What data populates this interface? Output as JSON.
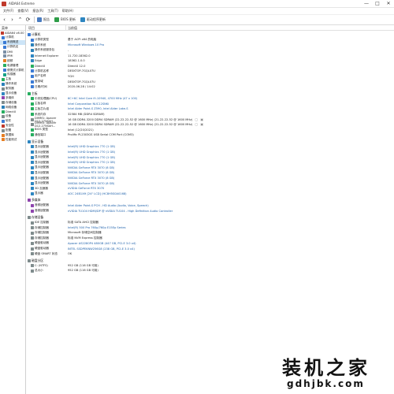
{
  "window": {
    "title": "AIDA64 Extreme",
    "controls": [
      "—",
      "□",
      "✕"
    ]
  },
  "menubar": {
    "items": [
      "文件(F)",
      "查看(V)",
      "报告(R)",
      "工具(T)",
      "帮助(H)"
    ]
  },
  "toolbar": {
    "nav": [
      "‹",
      "›",
      "⌃",
      "⟳"
    ],
    "items": [
      {
        "label": "报告",
        "color": "#4a7cc0"
      },
      {
        "label": "BIOS 更新",
        "color": "#2e9d48"
      },
      {
        "label": "驱动程序更新",
        "color": "#2e86c1"
      }
    ]
  },
  "sidebar": {
    "header": "菜单",
    "items": [
      {
        "label": "AIDA64 v6.00",
        "color": "#c0392b",
        "indent": 1
      },
      {
        "label": "计算机",
        "color": "#3a7bd5",
        "indent": 2
      },
      {
        "label": "系统概述",
        "color": "#3a7bd5",
        "indent": 4,
        "selected": true
      },
      {
        "label": "计算机名",
        "color": "#3a7bd5",
        "indent": 4
      },
      {
        "label": "DMI",
        "color": "#7b8fa6",
        "indent": 4
      },
      {
        "label": "IPMI",
        "color": "#7b8fa6",
        "indent": 4
      },
      {
        "label": "超频",
        "color": "#e67e22",
        "indent": 4
      },
      {
        "label": "电源管理",
        "color": "#27ae60",
        "indent": 4
      },
      {
        "label": "便携式计算机",
        "color": "#3a7bd5",
        "indent": 4
      },
      {
        "label": "传感器",
        "color": "#16a085",
        "indent": 4
      },
      {
        "label": "主板",
        "color": "#27ae60",
        "indent": 2
      },
      {
        "label": "操作系统",
        "color": "#2980b9",
        "indent": 2
      },
      {
        "label": "服务器",
        "color": "#7f8c8d",
        "indent": 2
      },
      {
        "label": "显示设备",
        "color": "#2e86c1",
        "indent": 2
      },
      {
        "label": "多媒体",
        "color": "#8e44ad",
        "indent": 2
      },
      {
        "label": "存储设备",
        "color": "#7f8c8d",
        "indent": 2
      },
      {
        "label": "网络设备",
        "color": "#2980b9",
        "indent": 2
      },
      {
        "label": "DirectX",
        "color": "#27ae60",
        "indent": 2
      },
      {
        "label": "设备",
        "color": "#7f8c8d",
        "indent": 2
      },
      {
        "label": "软件",
        "color": "#3a7bd5",
        "indent": 2
      },
      {
        "label": "安全性",
        "color": "#c0392b",
        "indent": 2
      },
      {
        "label": "配置",
        "color": "#7f8c8d",
        "indent": 2
      },
      {
        "label": "数据库",
        "color": "#e67e22",
        "indent": 2
      },
      {
        "label": "性能测试",
        "color": "#e67e22",
        "indent": 2
      }
    ]
  },
  "columns": {
    "field": "项目",
    "value": "当前值"
  },
  "sections": [
    {
      "title": "计算机",
      "color": "#3a7bd5",
      "rows": [
        {
          "field": "计算机类型",
          "value": "基于 ACPI x64 的电脑",
          "black": true,
          "color": "#3a7bd5"
        },
        {
          "field": "操作系统",
          "value": "Microsoft Windows 10 Pro",
          "color": "#2980b9"
        },
        {
          "field": "操作系统服务包",
          "value": "-",
          "black": true,
          "color": "#2980b9"
        },
        {
          "field": "Internet Explorer",
          "value": "11.720.18362.0",
          "black": true,
          "color": "#2e86c1"
        },
        {
          "field": "Edge",
          "value": "18362.1.0.0",
          "black": true,
          "color": "#2e86c1"
        },
        {
          "field": "DirectX",
          "value": "DirectX 12.0",
          "black": true,
          "color": "#27ae60"
        },
        {
          "field": "计算机名称",
          "value": "DESKTOP-7GQL07U",
          "black": true,
          "color": "#3a7bd5"
        },
        {
          "field": "用户名称",
          "value": "YGH",
          "black": true,
          "color": "#3a7bd5"
        },
        {
          "field": "登录域",
          "value": "DESKTOP-7GQL07U",
          "black": true,
          "color": "#3a7bd5"
        },
        {
          "field": "日期/时间",
          "value": "2020-06-28 / 14:02",
          "black": true,
          "color": "#3a7bd5"
        }
      ]
    },
    {
      "title": "主板",
      "color": "#27ae60",
      "rows": [
        {
          "field": "中央处理器(CPU)",
          "value": "6C+6C Intel Core i9-10940, 4700 MHz (47 x 100)",
          "color": "#27ae60"
        },
        {
          "field": "主板名称",
          "value": "Intel Corporation NUC12SNKi",
          "color": "#27ae60"
        },
        {
          "field": "主板芯片组",
          "value": "Intel Alder Point-S Z590, Intel Alder Lake-S",
          "color": "#27ae60"
        },
        {
          "field": "系统内存",
          "value": "32584 MB  (DDR4 SDRAM)",
          "black": true,
          "color": "#27ae60"
        },
        {
          "field": "DIMM1: Apacer D12.2756AH...",
          "value": "16 GB DDR4-3200 DDR4 SDRAM  (22-22-22-52 @ 1600 MHz)  (21-22-22-52 @ 1600 MHz)",
          "black": true,
          "color": "#7f8c8d",
          "icons": true
        },
        {
          "field": "DIMM3: Apacer D12.2756AH...",
          "value": "16 GB DDR4-3200 DDR4 SDRAM  (22-22-22-52 @ 1600 MHz)  (21-22-22-52 @ 1600 MHz)",
          "black": true,
          "color": "#7f8c8d",
          "icons": true
        },
        {
          "field": "BIOS 类型",
          "value": "Intel (12/20/2021)",
          "black": true,
          "color": "#27ae60"
        },
        {
          "field": "通信端口",
          "value": "Prolific PL2303GS USB Serial COM Port (COM3)",
          "black": true,
          "color": "#27ae60"
        }
      ]
    },
    {
      "title": "显示设备",
      "color": "#2e86c1",
      "rows": [
        {
          "field": "显示适配器",
          "value": "Intel(R) UHD Graphics 770  (1 GB)",
          "color": "#2e86c1"
        },
        {
          "field": "显示适配器",
          "value": "Intel(R) UHD Graphics 770  (1 GB)",
          "color": "#2e86c1"
        },
        {
          "field": "显示适配器",
          "value": "Intel(R) UHD Graphics 770  (1 GB)",
          "color": "#2e86c1"
        },
        {
          "field": "显示适配器",
          "value": "Intel(R) UHD Graphics 770  (1 GB)",
          "color": "#2e86c1"
        },
        {
          "field": "显示适配器",
          "value": "NVIDIA GeForce RTX 3070  (8 GB)",
          "color": "#2e86c1"
        },
        {
          "field": "显示适配器",
          "value": "NVIDIA GeForce RTX 3070  (8 GB)",
          "color": "#2e86c1"
        },
        {
          "field": "显示适配器",
          "value": "NVIDIA GeForce RTX 3070  (8 GB)",
          "color": "#2e86c1"
        },
        {
          "field": "显示适配器",
          "value": "NVIDIA GeForce RTX 3070  (8 GB)",
          "color": "#2e86c1"
        },
        {
          "field": "3D 加速器",
          "value": "nVIDIA GeForce RTX 3070",
          "color": "#2e86c1"
        },
        {
          "field": "显示器",
          "value": "AOC 24B1XH  [24\" LCD]  (HC8H5S0A0168)",
          "color": "#2e86c1"
        }
      ]
    },
    {
      "title": "多媒体",
      "color": "#8e44ad",
      "rows": [
        {
          "field": "音频适配器",
          "value": "Intel Alder Point-S PCH - HD Audio (Audio, Voice, Speech)",
          "color": "#8e44ad"
        },
        {
          "field": "音频适配器",
          "value": "nVIDIA TU104 HDMI/DP @ nVIDIA TU104 - High Definition Audio Controller",
          "color": "#8e44ad"
        }
      ]
    },
    {
      "title": "存储设备",
      "color": "#7f8c8d",
      "rows": [
        {
          "field": "IDE 控制器",
          "value": "标准 SATA AHCI 控制器",
          "black": true,
          "color": "#7f8c8d"
        },
        {
          "field": "存储控制器",
          "value": "Intel(R) 500 Pro 760p/760p E15Ep Series",
          "color": "#7f8c8d"
        },
        {
          "field": "存储控制器",
          "value": "Microsoft 存储空间控制器",
          "black": true,
          "color": "#7f8c8d"
        },
        {
          "field": "存储控制器",
          "value": "标准 NVM Express 控制器",
          "black": true,
          "color": "#7f8c8d"
        },
        {
          "field": "硬盘驱动器",
          "value": "Apacer AS2280P4 480GB  (447 GB, PCI-E 3.0 x4)",
          "color": "#7f8c8d"
        },
        {
          "field": "硬盘驱动器",
          "value": "INTEL SSDPEKNW256G8  (238 GB, PCI-E 3.0 x4)",
          "color": "#7f8c8d"
        },
        {
          "field": "硬盘 SMART 状态",
          "value": "OK",
          "black": true,
          "color": "#7f8c8d"
        }
      ]
    },
    {
      "title": "磁盘分区",
      "color": "#7f8c8d",
      "rows": [
        {
          "field": "C: (NTFS)",
          "value": "952 GB (116 GB 可用)",
          "black": true,
          "color": "#7f8c8d"
        },
        {
          "field": "总大小",
          "value": "952 GB (116 GB 可用)",
          "black": true,
          "color": "#7f8c8d"
        }
      ]
    }
  ],
  "watermark": {
    "cn": "装机之家",
    "en": "gdhjbk.com"
  }
}
